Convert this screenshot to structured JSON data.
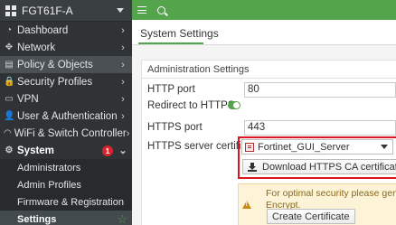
{
  "sidebar": {
    "device_name": "FGT61F-A",
    "items": [
      {
        "label": "Dashboard",
        "icon": "dashboard-icon",
        "glyph": "◔"
      },
      {
        "label": "Network",
        "icon": "network-icon",
        "glyph": "✥"
      },
      {
        "label": "Policy & Objects",
        "icon": "policy-icon",
        "glyph": "▤"
      },
      {
        "label": "Security Profiles",
        "icon": "security-profiles-icon",
        "glyph": "🔒"
      },
      {
        "label": "VPN",
        "icon": "vpn-icon",
        "glyph": "▭"
      },
      {
        "label": "User & Authentication",
        "icon": "user-icon",
        "glyph": "👤"
      },
      {
        "label": "WiFi & Switch Controller",
        "icon": "wifi-icon",
        "glyph": "◠"
      },
      {
        "label": "System",
        "icon": "gear-icon",
        "glyph": "⚙",
        "badge": "1"
      }
    ],
    "sub_items": [
      {
        "label": "Administrators"
      },
      {
        "label": "Admin Profiles"
      },
      {
        "label": "Firmware & Registration"
      },
      {
        "label": "Settings"
      }
    ]
  },
  "header": {
    "title": "System Settings"
  },
  "admin_settings": {
    "section_title": "Administration Settings",
    "http_port_label": "HTTP port",
    "http_port_value": "80",
    "redirect_label": "Redirect to HTTPS",
    "redirect_enabled": true,
    "https_port_label": "HTTPS port",
    "https_port_value": "443",
    "cert_label": "HTTPS server certificate",
    "cert_value": "Fortinet_GUI_Server",
    "download_button": "Download HTTPS CA certificate",
    "warning_line1": "For optimal security please generate a",
    "warning_line2": "Encrypt.",
    "create_cert_button": "Create Certificate"
  },
  "colors": {
    "accent_green": "#53a44a",
    "sidebar_bg": "#2f3336",
    "highlight_red": "#e0141e",
    "warning_bg": "#fdf3d6"
  }
}
